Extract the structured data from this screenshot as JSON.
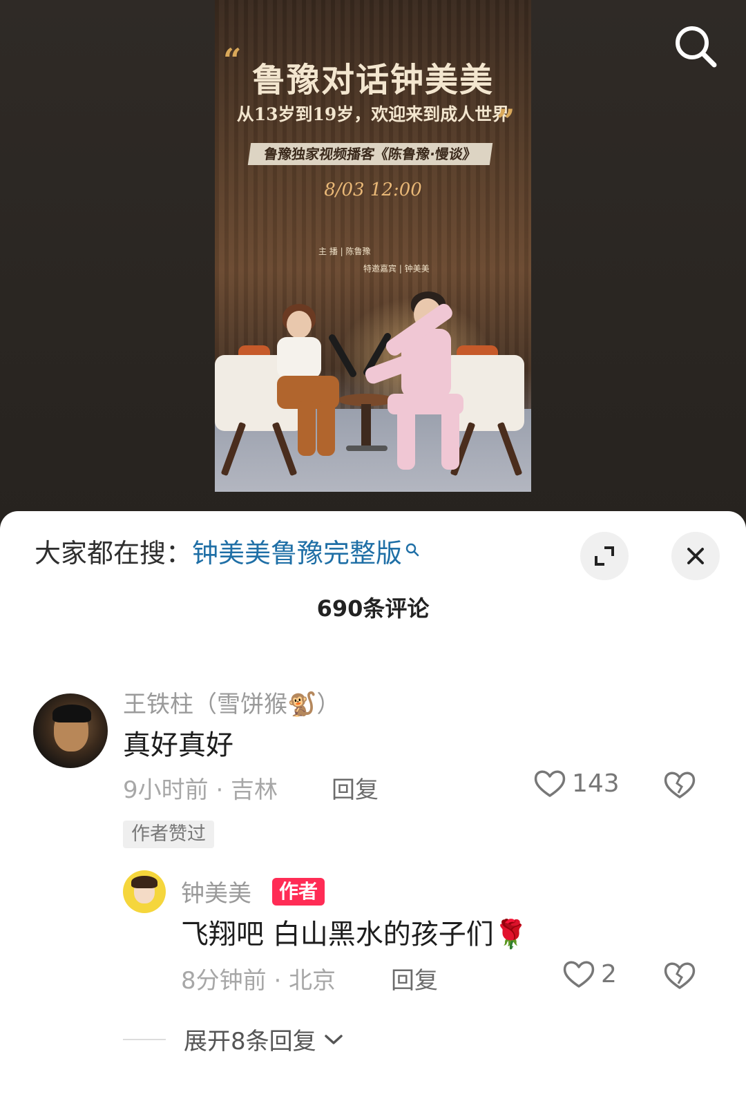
{
  "poster": {
    "title": "鲁豫对话钟美美",
    "subtitle": "从13岁到19岁，欢迎来到成人世界",
    "podcast_tag": "鲁豫独家视频播客《陈鲁豫·慢谈》",
    "datetime": "8/03 12:00",
    "credit_host": "主 播 | 陈鲁豫",
    "credit_guest": "特邀嘉宾 | 钟美美",
    "quote_open": "“",
    "quote_close": "”"
  },
  "top_bar": {
    "search_icon": "search-icon"
  },
  "sheet": {
    "hot_search_label": "大家都在搜：",
    "hot_search_term": "钟美美鲁豫完整版",
    "expand_icon": "expand-icon",
    "close_icon": "close-icon",
    "comment_count": "690条评论"
  },
  "comments": [
    {
      "username": "王铁柱（雪饼猴🐒）",
      "text": "真好真好",
      "time_location": "9小时前 · 吉林",
      "reply_label": "回复",
      "likes": "143",
      "liked_badge": "作者赞过",
      "replies": [
        {
          "username": "钟美美",
          "author_badge": "作者",
          "text": "飞翔吧 白山黑水的孩子们🌹",
          "time_location": "8分钟前 · 北京",
          "reply_label": "回复",
          "likes": "2"
        }
      ],
      "expand_label": "展开8条回复"
    }
  ],
  "colors": {
    "accent_link": "#1f6fa6",
    "author_badge_bg": "#ff2c55",
    "sheet_bg": "#ffffff",
    "video_bg": "#2b2724"
  }
}
